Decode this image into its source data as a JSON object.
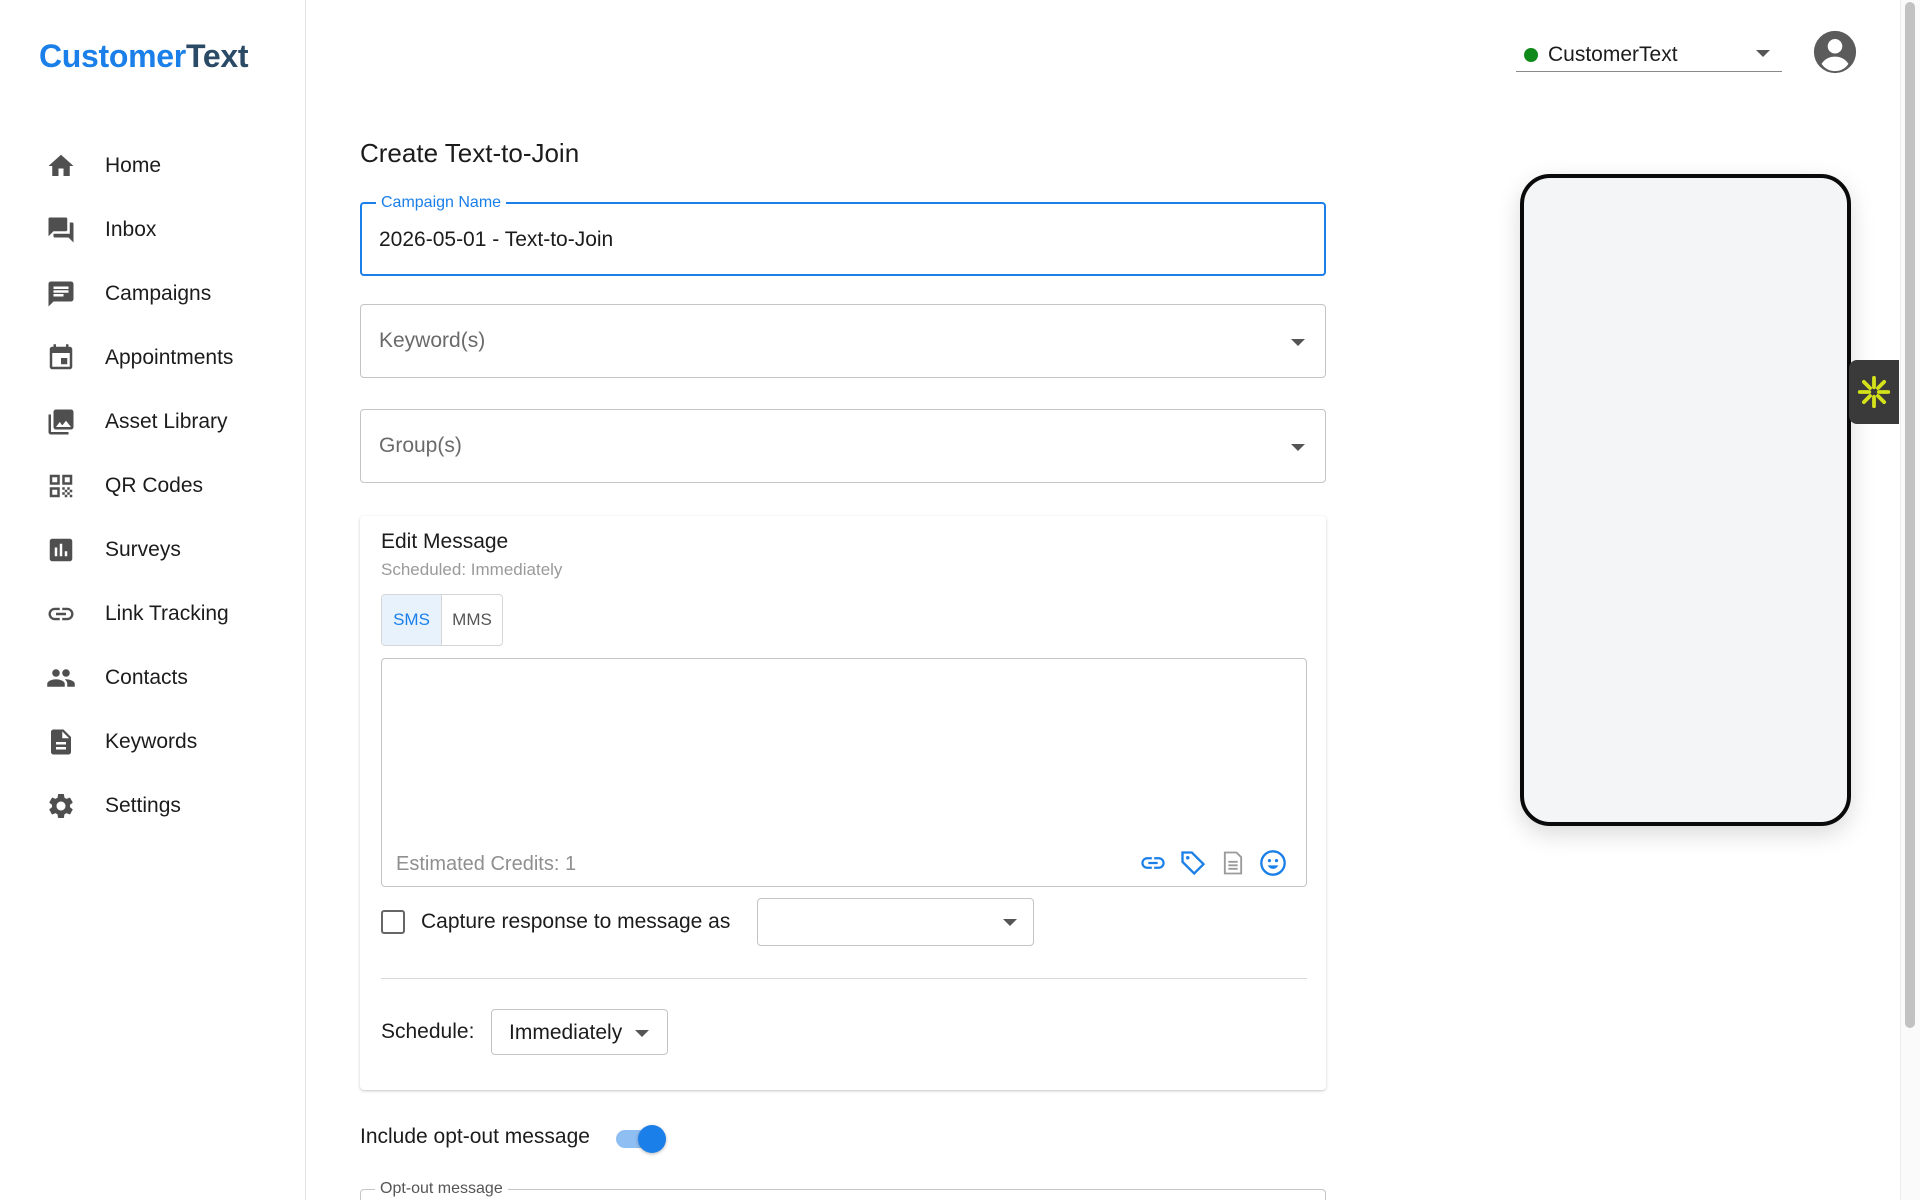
{
  "brand": {
    "part1": "Customer",
    "part2": "Text"
  },
  "sidebar": {
    "items": [
      {
        "label": "Home",
        "icon": "home-icon"
      },
      {
        "label": "Inbox",
        "icon": "inbox-icon"
      },
      {
        "label": "Campaigns",
        "icon": "campaigns-icon"
      },
      {
        "label": "Appointments",
        "icon": "calendar-icon"
      },
      {
        "label": "Asset Library",
        "icon": "image-library-icon"
      },
      {
        "label": "QR Codes",
        "icon": "qr-code-icon"
      },
      {
        "label": "Surveys",
        "icon": "bar-chart-icon"
      },
      {
        "label": "Link Tracking",
        "icon": "link-icon"
      },
      {
        "label": "Contacts",
        "icon": "people-icon"
      },
      {
        "label": "Keywords",
        "icon": "document-icon"
      },
      {
        "label": "Settings",
        "icon": "gear-icon"
      }
    ]
  },
  "header": {
    "account_name": "CustomerText",
    "account_status_color": "#0f8a1a"
  },
  "form": {
    "title": "Create Text-to-Join",
    "campaign_name_label": "Campaign Name",
    "campaign_name_value": "2026-05-01 - Text-to-Join",
    "keywords_placeholder": "Keyword(s)",
    "groups_placeholder": "Group(s)",
    "message": {
      "title": "Edit Message",
      "subtitle": "Scheduled: Immediately",
      "type_options": [
        "SMS",
        "MMS"
      ],
      "active_type": "SMS",
      "body": "",
      "credits": "Estimated Credits: 1",
      "capture_label": "Capture response to message as",
      "capture_value": "",
      "schedule_label": "Schedule:",
      "schedule_value": "Immediately"
    },
    "optout_label": "Include opt-out message",
    "optout_enabled": true,
    "optout_field_label": "Opt-out message"
  },
  "colors": {
    "accent": "#1a7fe8",
    "brand_dark": "#2a4a66",
    "widget_star": "#d4e21a"
  }
}
